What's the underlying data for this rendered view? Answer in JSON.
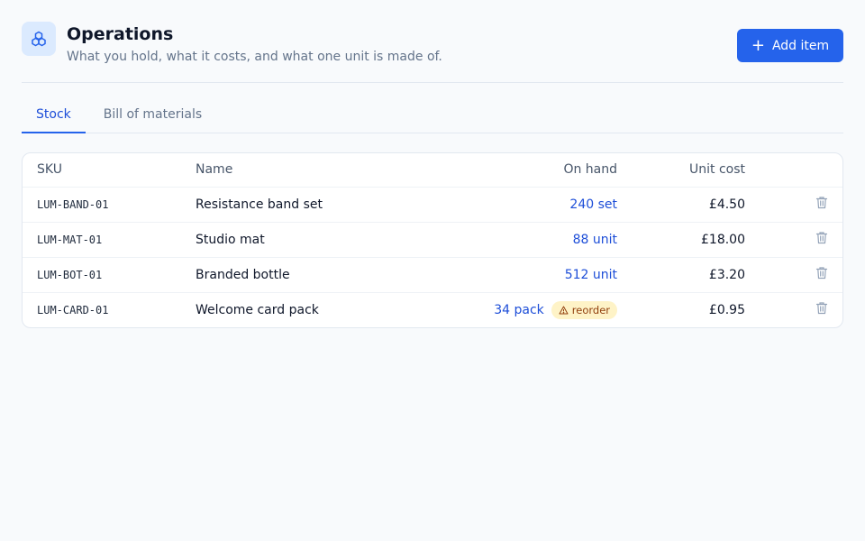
{
  "header": {
    "title": "Operations",
    "subtitle": "What you hold, what it costs, and what one unit is made of.",
    "add_label": "Add item",
    "app_icon": "cubes-icon"
  },
  "tabs": [
    {
      "label": "Stock",
      "active": true
    },
    {
      "label": "Bill of materials",
      "active": false
    }
  ],
  "table": {
    "columns": [
      "SKU",
      "Name",
      "On hand",
      "Unit cost"
    ],
    "rows": [
      {
        "sku": "LUM-BAND-01",
        "name": "Resistance band set",
        "on_hand": "240 set",
        "unit_cost": "£4.50",
        "badge": ""
      },
      {
        "sku": "LUM-MAT-01",
        "name": "Studio mat",
        "on_hand": "88 unit",
        "unit_cost": "£18.00",
        "badge": ""
      },
      {
        "sku": "LUM-BOT-01",
        "name": "Branded bottle",
        "on_hand": "512 unit",
        "unit_cost": "£3.20",
        "badge": ""
      },
      {
        "sku": "LUM-CARD-01",
        "name": "Welcome card pack",
        "on_hand": "34 pack",
        "unit_cost": "£0.95",
        "badge": "reorder"
      }
    ]
  },
  "colors": {
    "accent": "#2563eb",
    "quantity": "#1d4ed8",
    "warning_bg": "#fef3c7",
    "warning_text": "#92400e"
  }
}
